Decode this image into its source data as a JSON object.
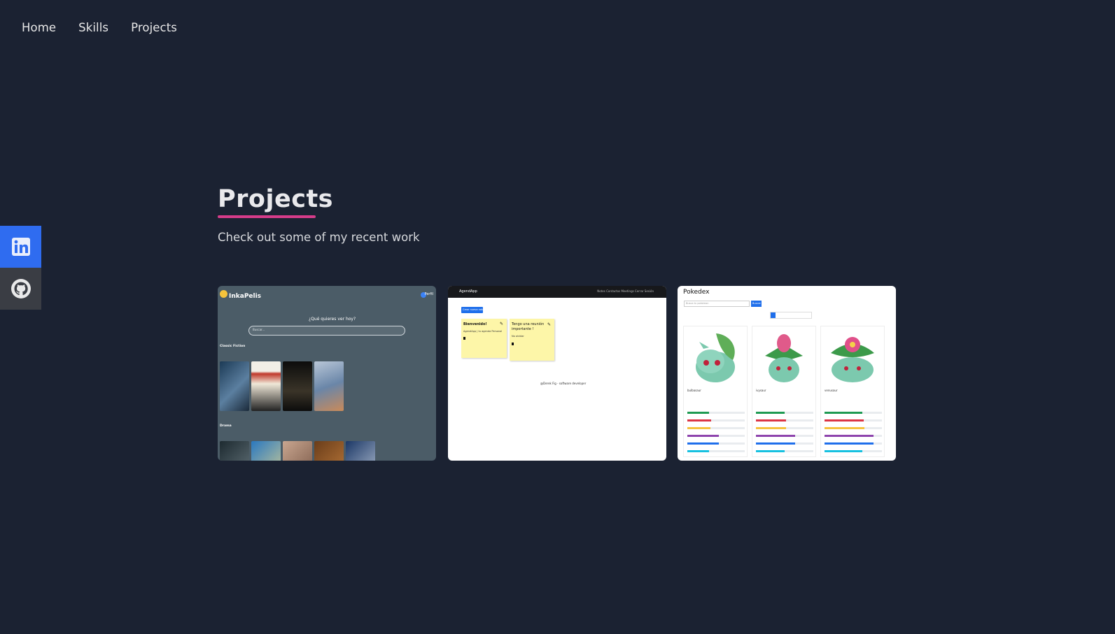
{
  "nav": {
    "items": [
      "Home",
      "Skills",
      "Projects"
    ]
  },
  "social": {
    "linkedin_icon": "linkedin-icon",
    "github_icon": "github-icon",
    "linkedin_color": "#2f6cf0",
    "github_color": "#3a3d44"
  },
  "section": {
    "title": "Projects",
    "subtitle": "Check out some of my recent work",
    "underline_color": "#d63c8a"
  },
  "projects": [
    {
      "brand": "InkaPelis",
      "profile_label": "Perfil",
      "question": "¿Qué quieres ver hoy?",
      "search_placeholder": "Buscar...",
      "section_1": "Classic Fiction",
      "section_2": "Drama"
    },
    {
      "app_name": "AgendApp",
      "nav_links": "Notes   Contactos   Meetings   Cerrar Sesión",
      "new_button": "Crear nueva nota",
      "note_1_title": "Bienvenido!",
      "note_1_body": "AgendApp | tu agenda Personal",
      "note_2_title": "Tengo una reunión importante !",
      "note_2_body": "No olvidar",
      "footer": "@Derek Fig - software developer"
    },
    {
      "title": "Pokedex",
      "search_placeholder": "Busca tu pokemon",
      "search_button": "Buscar",
      "pokemon": [
        "bulbasaur",
        "ivysaur",
        "venusaur"
      ],
      "stat_colors": [
        "#1e9a52",
        "#dc3545",
        "#f6c23e",
        "#8e44ad",
        "#1f6feb",
        "#17c1e0"
      ]
    }
  ]
}
